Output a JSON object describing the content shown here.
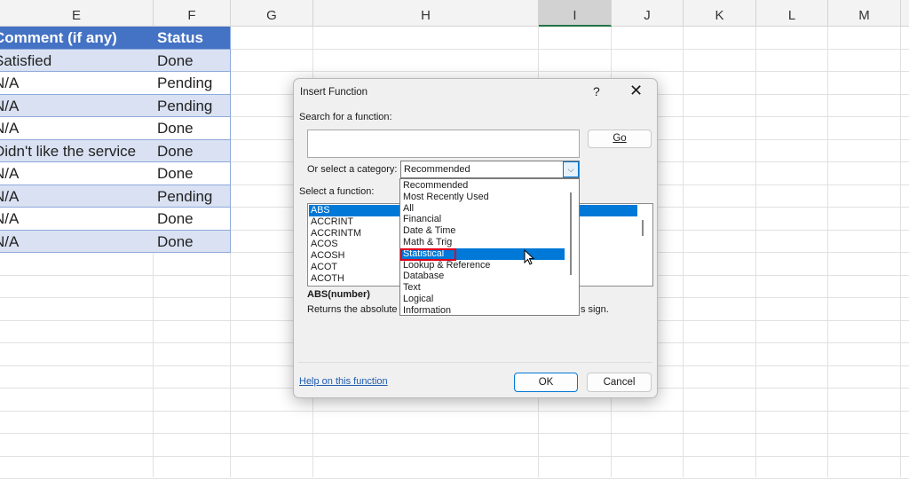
{
  "sheet": {
    "columns": [
      "E",
      "F",
      "G",
      "H",
      "I",
      "J",
      "K",
      "L",
      "M"
    ],
    "selected_column": "I",
    "header": {
      "comment": "Comment (if any)",
      "status": "Status"
    },
    "rows": [
      {
        "comment": "Satisfied",
        "status": "Done"
      },
      {
        "comment": "N/A",
        "status": "Pending"
      },
      {
        "comment": "N/A",
        "status": "Pending"
      },
      {
        "comment": "N/A",
        "status": "Done"
      },
      {
        "comment": "Didn't like the service",
        "status": "Done"
      },
      {
        "comment": "N/A",
        "status": "Done"
      },
      {
        "comment": "N/A",
        "status": "Pending"
      },
      {
        "comment": "N/A",
        "status": "Done"
      },
      {
        "comment": "N/A",
        "status": "Done"
      }
    ],
    "colors": {
      "header_fill": "#4472C4",
      "band_fill": "#D9E1F2",
      "selected_col": "#217346"
    }
  },
  "dialog": {
    "title": "Insert Function",
    "help_icon": "?",
    "close_icon": "✕",
    "search_label": "Search for a function:",
    "search_value": "",
    "go_label": "Go",
    "category_label": "Or select a category:",
    "category_value": "Recommended",
    "category_options": [
      "Recommended",
      "Most Recently Used",
      "All",
      "Financial",
      "Date & Time",
      "Math & Trig",
      "Statistical",
      "Lookup & Reference",
      "Database",
      "Text",
      "Logical",
      "Information"
    ],
    "highlighted_option": "Statistical",
    "function_label": "Select a function:",
    "functions": [
      "ABS",
      "ACCRINT",
      "ACCRINTM",
      "ACOS",
      "ACOSH",
      "ACOT",
      "ACOTH"
    ],
    "selected_function": "ABS",
    "signature": "ABS(number)",
    "description_start": "Returns the absolute",
    "description_end": "s sign.",
    "help_link": "Help on this function",
    "ok_label": "OK",
    "cancel_label": "Cancel"
  }
}
